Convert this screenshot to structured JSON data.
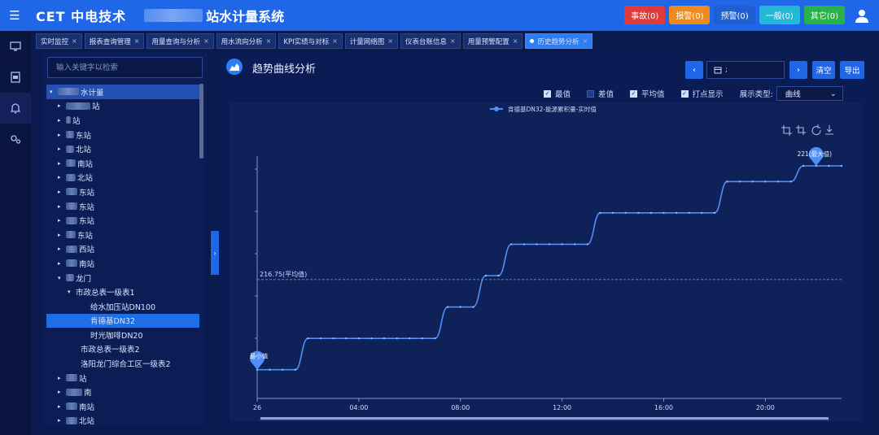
{
  "header": {
    "logo": "CET 中电技术",
    "system_title": "站水计量系统",
    "alarms": [
      {
        "label": "事故(0)",
        "color": "#e03a3a"
      },
      {
        "label": "报警(0)",
        "color": "#f08a1c"
      },
      {
        "label": "预警(0)",
        "color": "#1f5fd0"
      },
      {
        "label": "一般(0)",
        "color": "#22b8d6"
      },
      {
        "label": "其它(0)",
        "color": "#25b34a"
      }
    ]
  },
  "tabs": [
    {
      "label": "实时监控",
      "active": false
    },
    {
      "label": "报表查询管理",
      "active": false
    },
    {
      "label": "用量查询与分析",
      "active": false
    },
    {
      "label": "用水流向分析",
      "active": false
    },
    {
      "label": "KPI实绩与对标",
      "active": false
    },
    {
      "label": "计量网络图",
      "active": false
    },
    {
      "label": "仪表台账信息",
      "active": false
    },
    {
      "label": "用量预警配置",
      "active": false
    },
    {
      "label": "历史趋势分析",
      "active": true
    }
  ],
  "tree": {
    "search_placeholder": "输入关键字以检索",
    "root": "水计量",
    "nodes": [
      {
        "label": "站",
        "blur": 30,
        "arrow": "▸",
        "indent": 14
      },
      {
        "label": "站",
        "blur": 6,
        "arrow": "▸",
        "indent": 14
      },
      {
        "label": "东站",
        "blur": 10,
        "arrow": "▸",
        "indent": 14
      },
      {
        "label": "北站",
        "blur": 10,
        "arrow": "▸",
        "indent": 14
      },
      {
        "label": "南站",
        "blur": 12,
        "arrow": "▸",
        "indent": 14
      },
      {
        "label": "北站",
        "blur": 12,
        "arrow": "▸",
        "indent": 14
      },
      {
        "label": "东站",
        "blur": 14,
        "arrow": "▸",
        "indent": 14
      },
      {
        "label": "东站",
        "blur": 14,
        "arrow": "▸",
        "indent": 14
      },
      {
        "label": "东站",
        "blur": 14,
        "arrow": "▸",
        "indent": 14
      },
      {
        "label": "东站",
        "blur": 12,
        "arrow": "▸",
        "indent": 14
      },
      {
        "label": "西站",
        "blur": 14,
        "arrow": "▸",
        "indent": 14
      },
      {
        "label": "南站",
        "blur": 14,
        "arrow": "▸",
        "indent": 14
      },
      {
        "label": "龙门",
        "blur": 10,
        "arrow": "▾",
        "indent": 14
      },
      {
        "label": "市政总表一级表1",
        "blur": 0,
        "arrow": "▾",
        "indent": 26
      },
      {
        "label": "给水加压站DN100",
        "blur": 0,
        "arrow": "",
        "indent": 44
      },
      {
        "label": "肯德基DN32",
        "blur": 0,
        "arrow": "",
        "indent": 44,
        "selected": true
      },
      {
        "label": "时光咖啡DN20",
        "blur": 0,
        "arrow": "",
        "indent": 44
      },
      {
        "label": "市政总表一级表2",
        "blur": 0,
        "arrow": "",
        "indent": 32
      },
      {
        "label": "洛阳龙门综合工区一级表2",
        "blur": 0,
        "arrow": "",
        "indent": 32
      },
      {
        "label": "站",
        "blur": 14,
        "arrow": "▸",
        "indent": 14
      },
      {
        "label": "南",
        "blur": 20,
        "arrow": "▸",
        "indent": 14
      },
      {
        "label": "南站",
        "blur": 14,
        "arrow": "▸",
        "indent": 14
      },
      {
        "label": "北站",
        "blur": 14,
        "arrow": "▸",
        "indent": 14
      }
    ]
  },
  "main": {
    "title": "趋势曲线分析",
    "date_value": ";",
    "clear_label": "清空",
    "export_label": "导出",
    "options": [
      {
        "label": "最值",
        "checked": true
      },
      {
        "label": "差值",
        "checked": false
      },
      {
        "label": "平均值",
        "checked": true
      },
      {
        "label": "打点显示",
        "checked": true
      }
    ],
    "display_type_label": "展示类型:",
    "display_type_value": "曲线"
  },
  "chart_data": {
    "type": "line",
    "legend": "肯德基DN32-能源累积量-实时值",
    "x_tick_labels": [
      "26",
      "04:00",
      "08:00",
      "12:00",
      "16:00",
      "20:00"
    ],
    "x_tick_hours": [
      0,
      4,
      8,
      12,
      16,
      20
    ],
    "x_range_hours": [
      0,
      23.0
    ],
    "ylim": [
      210,
      224
    ],
    "series": [
      {
        "name": "肯德基DN32-能源累积量-实时值",
        "color": "#4f8ff7",
        "points": [
          [
            0,
            211
          ],
          [
            0.5,
            211
          ],
          [
            1,
            211
          ],
          [
            1.5,
            211
          ],
          [
            2,
            213
          ],
          [
            2.5,
            213
          ],
          [
            3,
            213
          ],
          [
            3.5,
            213
          ],
          [
            4,
            213
          ],
          [
            4.5,
            213
          ],
          [
            5,
            213
          ],
          [
            5.5,
            213
          ],
          [
            6,
            213
          ],
          [
            6.5,
            213
          ],
          [
            7,
            213
          ],
          [
            7.5,
            215
          ],
          [
            8,
            215
          ],
          [
            8.5,
            215
          ],
          [
            9,
            217
          ],
          [
            9.5,
            217
          ],
          [
            10,
            219
          ],
          [
            10.5,
            219
          ],
          [
            11,
            219
          ],
          [
            11.5,
            219
          ],
          [
            12,
            219
          ],
          [
            12.5,
            219
          ],
          [
            13,
            219
          ],
          [
            13.5,
            221
          ],
          [
            14,
            221
          ],
          [
            14.5,
            221
          ],
          [
            15,
            221
          ],
          [
            15.5,
            221
          ],
          [
            16,
            221
          ],
          [
            16.5,
            221
          ],
          [
            17,
            221
          ],
          [
            17.5,
            221
          ],
          [
            18,
            221
          ],
          [
            18.5,
            223
          ],
          [
            19,
            223
          ],
          [
            19.5,
            223
          ],
          [
            20,
            223
          ],
          [
            20.5,
            223
          ],
          [
            21,
            223
          ],
          [
            21.5,
            224
          ],
          [
            22,
            224
          ],
          [
            22.5,
            224
          ],
          [
            23,
            224
          ]
        ]
      }
    ],
    "avg_value": 216.75,
    "avg_label": "216.75(平均值)",
    "max_label": "221(最大值)",
    "max_x": 22,
    "min_label": "最小值",
    "min_x": 0,
    "dataZoom": true
  }
}
